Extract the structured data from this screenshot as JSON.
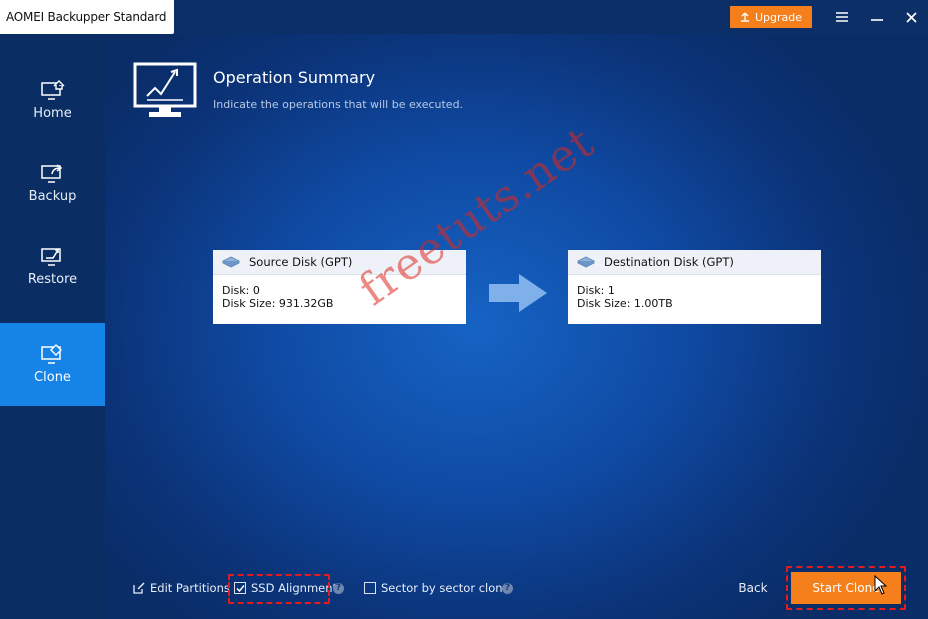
{
  "window": {
    "title": "AOMEI Backupper Standard",
    "upgrade_label": "Upgrade",
    "accent_color": "#f47f1b"
  },
  "sidebar": {
    "items": [
      {
        "label": "Home",
        "icon": "home-monitor-icon",
        "active": false
      },
      {
        "label": "Backup",
        "icon": "backup-monitor-icon",
        "active": false
      },
      {
        "label": "Restore",
        "icon": "restore-monitor-icon",
        "active": false
      },
      {
        "label": "Clone",
        "icon": "clone-monitor-icon",
        "active": true
      }
    ],
    "active_color": "#1683e7"
  },
  "header": {
    "title": "Operation Summary",
    "subtitle": "Indicate the operations that will be executed."
  },
  "source_disk": {
    "title": "Source Disk (GPT)",
    "disk_line": "Disk: 0",
    "size_line": "Disk Size: 931.32GB"
  },
  "destination_disk": {
    "title": "Destination Disk (GPT)",
    "disk_line": "Disk: 1",
    "size_line": "Disk Size: 1.00TB"
  },
  "watermark": "freetuts.net",
  "footer": {
    "edit_partitions": "Edit Partitions",
    "ssd_alignment": "SSD Alignment",
    "ssd_alignment_checked": true,
    "sector_by_sector": "Sector by sector clone",
    "sector_by_sector_checked": false,
    "back_label": "Back",
    "start_clone_label": "Start Clone"
  }
}
